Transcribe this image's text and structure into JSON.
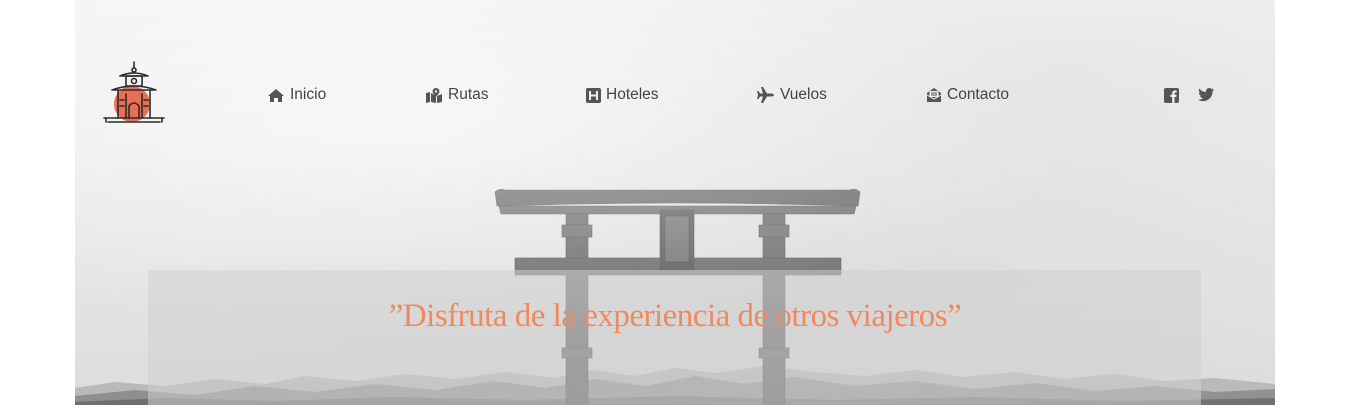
{
  "brand": {
    "logo_icon": "shrine-pagoda-icon",
    "accent": "#e8664a"
  },
  "nav": {
    "items": [
      {
        "label": "Inicio",
        "icon": "home-icon"
      },
      {
        "label": "Rutas",
        "icon": "map-marked-icon"
      },
      {
        "label": "Hoteles",
        "icon": "hotel-h-icon"
      },
      {
        "label": "Vuelos",
        "icon": "plane-icon"
      },
      {
        "label": "Contacto",
        "icon": "envelope-open-icon"
      }
    ],
    "color": "#444444"
  },
  "social": {
    "items": [
      {
        "icon": "facebook-square-icon"
      },
      {
        "icon": "twitter-icon"
      }
    ],
    "color": "#555555"
  },
  "hero": {
    "quote": "”Disfruta de la experiencia de otros viajeros”",
    "quote_color": "#f08a5d",
    "image": "torii-gate-lake-icon"
  }
}
